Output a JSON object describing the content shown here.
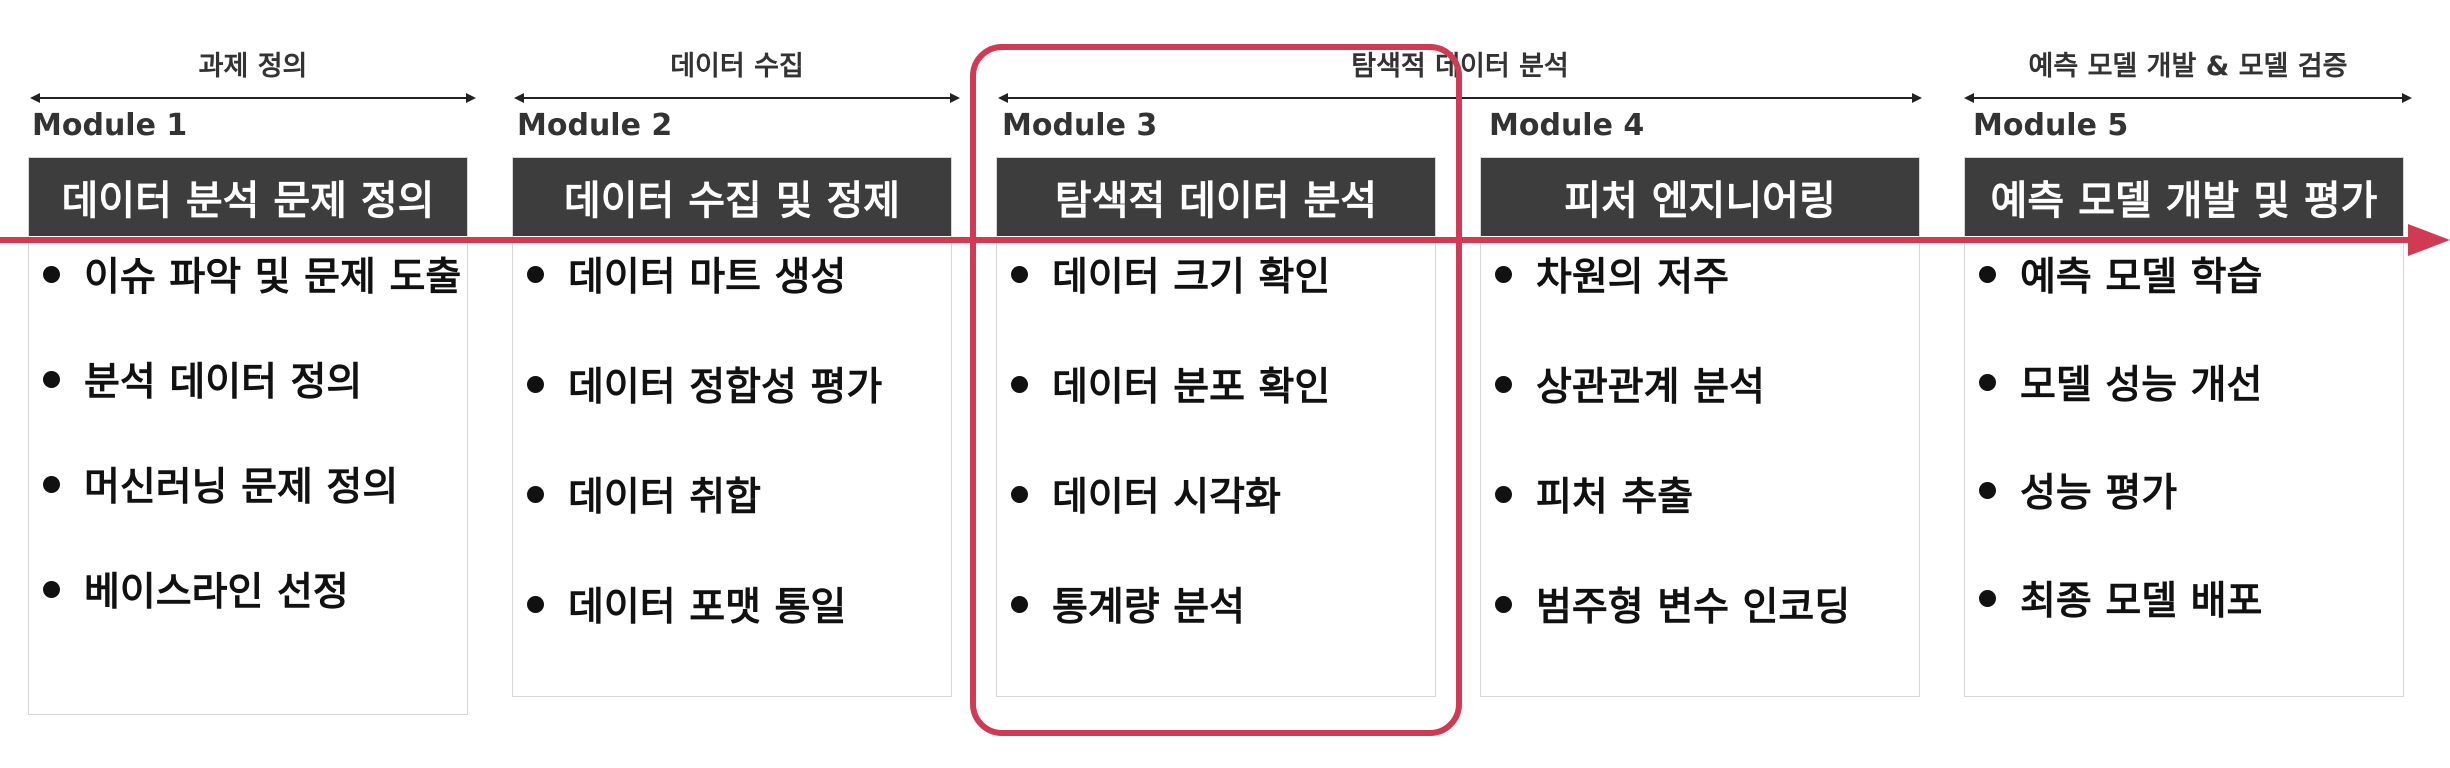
{
  "phases": [
    {
      "label": "과제 정의"
    },
    {
      "label": "데이터 수집"
    },
    {
      "label": "탐색적 데이터 분석"
    },
    {
      "label": "예측 모델 개발 & 모델 검증"
    }
  ],
  "modules": [
    {
      "label": "Module 1",
      "title": "데이터 분석 문제 정의",
      "items": [
        "이슈 파악 및 문제 도출",
        "분석 데이터 정의",
        "머신러닝 문제 정의",
        "베이스라인 선정"
      ]
    },
    {
      "label": "Module 2",
      "title": "데이터 수집 및 정제",
      "items": [
        "데이터 마트 생성",
        "데이터 정합성 평가",
        "데이터 취합",
        "데이터 포맷 통일"
      ]
    },
    {
      "label": "Module 3",
      "title": "탐색적 데이터 분석",
      "items": [
        "데이터 크기 확인",
        "데이터 분포 확인",
        "데이터 시각화",
        "통계량 분석"
      ]
    },
    {
      "label": "Module 4",
      "title": "피처 엔지니어링",
      "items": [
        "차원의 저주",
        "상관관계 분석",
        "피처 추출",
        "범주형 변수 인코딩"
      ]
    },
    {
      "label": "Module 5",
      "title": "예측 모델 개발 및 평가",
      "items": [
        "예측 모델 학습",
        "모델 성능 개선",
        "성능 평가",
        "최종 모델 배포"
      ]
    }
  ],
  "colors": {
    "timeline": "#d03a52",
    "highlight": "#d03a52",
    "header_bg": "#3d3d3d"
  }
}
